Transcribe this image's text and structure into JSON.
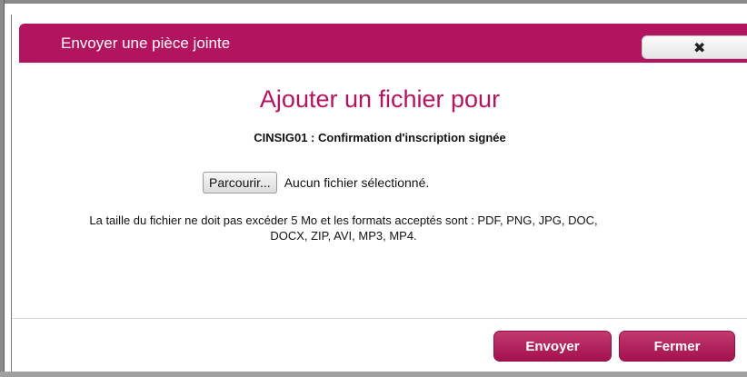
{
  "dialog": {
    "title": "Envoyer une pièce jointe",
    "close_icon": "close-icon",
    "close_glyph": "✖"
  },
  "content": {
    "heading": "Ajouter un fichier pour",
    "document_label": "CINSIG01 : Confirmation d'inscription signée",
    "browse_label": "Parcourir...",
    "file_status": "Aucun fichier sélectionné.",
    "info_line1": "La taille du fichier ne doit pas excéder 5 Mo et les formats acceptés sont : PDF, PNG, JPG, DOC,",
    "info_line2": "DOCX, ZIP, AVI, MP3, MP4."
  },
  "footer": {
    "send_label": "Envoyer",
    "close_label": "Fermer"
  },
  "colors": {
    "brand": "#b3145f",
    "button": "#a5114f"
  }
}
